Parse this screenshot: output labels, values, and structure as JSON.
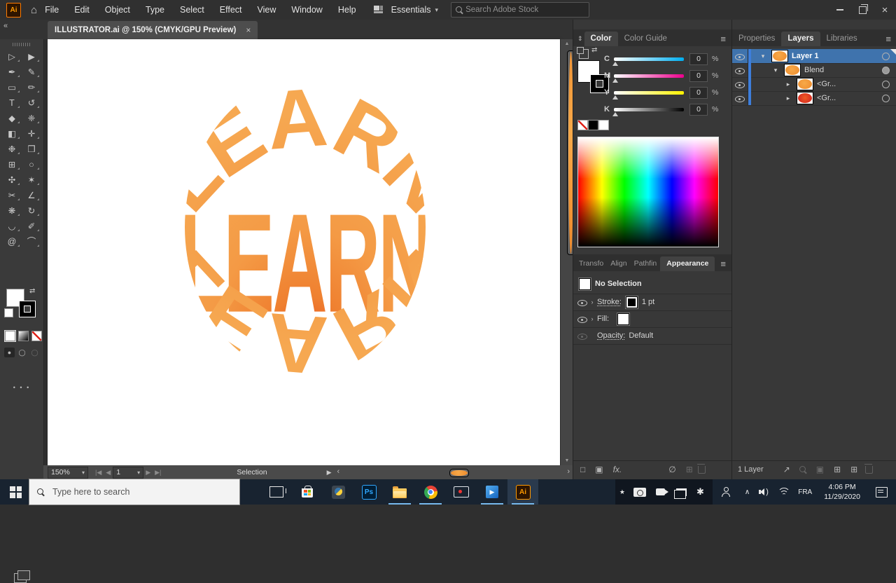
{
  "menubar": {
    "items": [
      "File",
      "Edit",
      "Object",
      "Type",
      "Select",
      "Effect",
      "View",
      "Window",
      "Help"
    ],
    "app_logo": "Ai",
    "workspace": "Essentials",
    "workspace_chevron": "▾",
    "stock_search_placeholder": "Search Adobe Stock",
    "close_glyph": "×"
  },
  "doc_tab": {
    "title": "ILLUSTRATOR.ai @ 150% (CMYK/GPU Preview)",
    "close": "×"
  },
  "tool_panel": {
    "collapse": "«",
    "more": "• • •",
    "tools": [
      {
        "name": "selection",
        "glyph": "▷"
      },
      {
        "name": "direct-selection",
        "glyph": "▶"
      },
      {
        "name": "pen",
        "glyph": "✒"
      },
      {
        "name": "curvature",
        "glyph": "✎"
      },
      {
        "name": "rectangle",
        "glyph": "▭"
      },
      {
        "name": "paintbrush",
        "glyph": "✏"
      },
      {
        "name": "type",
        "glyph": "T"
      },
      {
        "name": "rotate",
        "glyph": "↺"
      },
      {
        "name": "eraser",
        "glyph": "◆"
      },
      {
        "name": "shaper",
        "glyph": "❈"
      },
      {
        "name": "gradient",
        "glyph": "◧"
      },
      {
        "name": "eyedropper",
        "glyph": "✛"
      },
      {
        "name": "puppet-warp",
        "glyph": "❉"
      },
      {
        "name": "shape-builder",
        "glyph": "❒"
      },
      {
        "name": "artboard",
        "glyph": "⊞"
      },
      {
        "name": "zoom",
        "glyph": "○"
      },
      {
        "name": "width",
        "glyph": "✣"
      },
      {
        "name": "magic-wand",
        "glyph": "✶"
      },
      {
        "name": "scissors",
        "glyph": "✂"
      },
      {
        "name": "measure",
        "glyph": "∠"
      },
      {
        "name": "symbol-sprayer",
        "glyph": "❋"
      },
      {
        "name": "rotate-view",
        "glyph": "↻"
      },
      {
        "name": "lasso",
        "glyph": "◡"
      },
      {
        "name": "pencil",
        "glyph": "✐"
      },
      {
        "name": "spiral",
        "glyph": "@"
      },
      {
        "name": "arc",
        "glyph": "⌒"
      }
    ]
  },
  "color_panel": {
    "updown": "⇕",
    "tab_color": "Color",
    "tab_guide": "Color Guide",
    "menu": "≡",
    "sliders": [
      {
        "label": "C",
        "value": "0",
        "unit": "%"
      },
      {
        "label": "M",
        "value": "0",
        "unit": "%"
      },
      {
        "label": "Y",
        "value": "0",
        "unit": "%"
      },
      {
        "label": "K",
        "value": "0",
        "unit": "%"
      }
    ]
  },
  "appearance_panel": {
    "tab_transform": "Transfo",
    "tab_align": "Align",
    "tab_pathfinder": "Pathfin",
    "tab_appearance": "Appearance",
    "menu": "≡",
    "no_selection": "No Selection",
    "stroke_label": "Stroke:",
    "stroke_value": "1 pt",
    "fill_label": "Fill:",
    "opacity_label": "Opacity:",
    "opacity_value": "Default",
    "chevron": "›",
    "footer": {
      "new_stroke": "□",
      "new_fill": "▣",
      "fx": "fx.",
      "clear": "∅",
      "duplicate": "⊞"
    }
  },
  "layers_panel": {
    "tab_properties": "Properties",
    "tab_layers": "Layers",
    "tab_libraries": "Libraries",
    "menu": "≡",
    "rows": [
      {
        "chevron": "▾",
        "label": "Layer 1"
      },
      {
        "chevron": "▾",
        "label": "Blend"
      },
      {
        "chevron": "▸",
        "label": "<Gr..."
      },
      {
        "chevron": "▸",
        "label": "<Gr..."
      }
    ],
    "footer_count": "1 Layer",
    "footer": {
      "export": "↗",
      "sublayer": "⊞",
      "new_layer": "⊞",
      "mask": "▣"
    }
  },
  "statusbar": {
    "zoom": "150%",
    "zoom_chevron": "▾",
    "first": "|◀",
    "prev": "◀",
    "page": "1",
    "page_chevron": "▾",
    "next": "▶",
    "last": "▶|",
    "status": "Selection",
    "panel_arrow": "▶",
    "scroll_left": "‹",
    "scroll_right": "›",
    "scroll_up": "▲",
    "scroll_down": "▼"
  },
  "artwork": {
    "word": "LEARN"
  },
  "taskbar": {
    "search_placeholder": "Type here to search",
    "ps_label": "Ps",
    "ai_label": "Ai",
    "play": "▶",
    "star": "★",
    "gear": "✱",
    "hidden_chevron": "∧",
    "lang": "FRA",
    "time": "4:06 PM",
    "date": "11/29/2020"
  },
  "colors": {
    "artwork_orange": "#f5a04a",
    "artwork_core": "#e23a12",
    "selection_blue": "#3f73ad",
    "cyan": "#00aeef",
    "magenta": "#ec008c",
    "yellow": "#fff200"
  }
}
